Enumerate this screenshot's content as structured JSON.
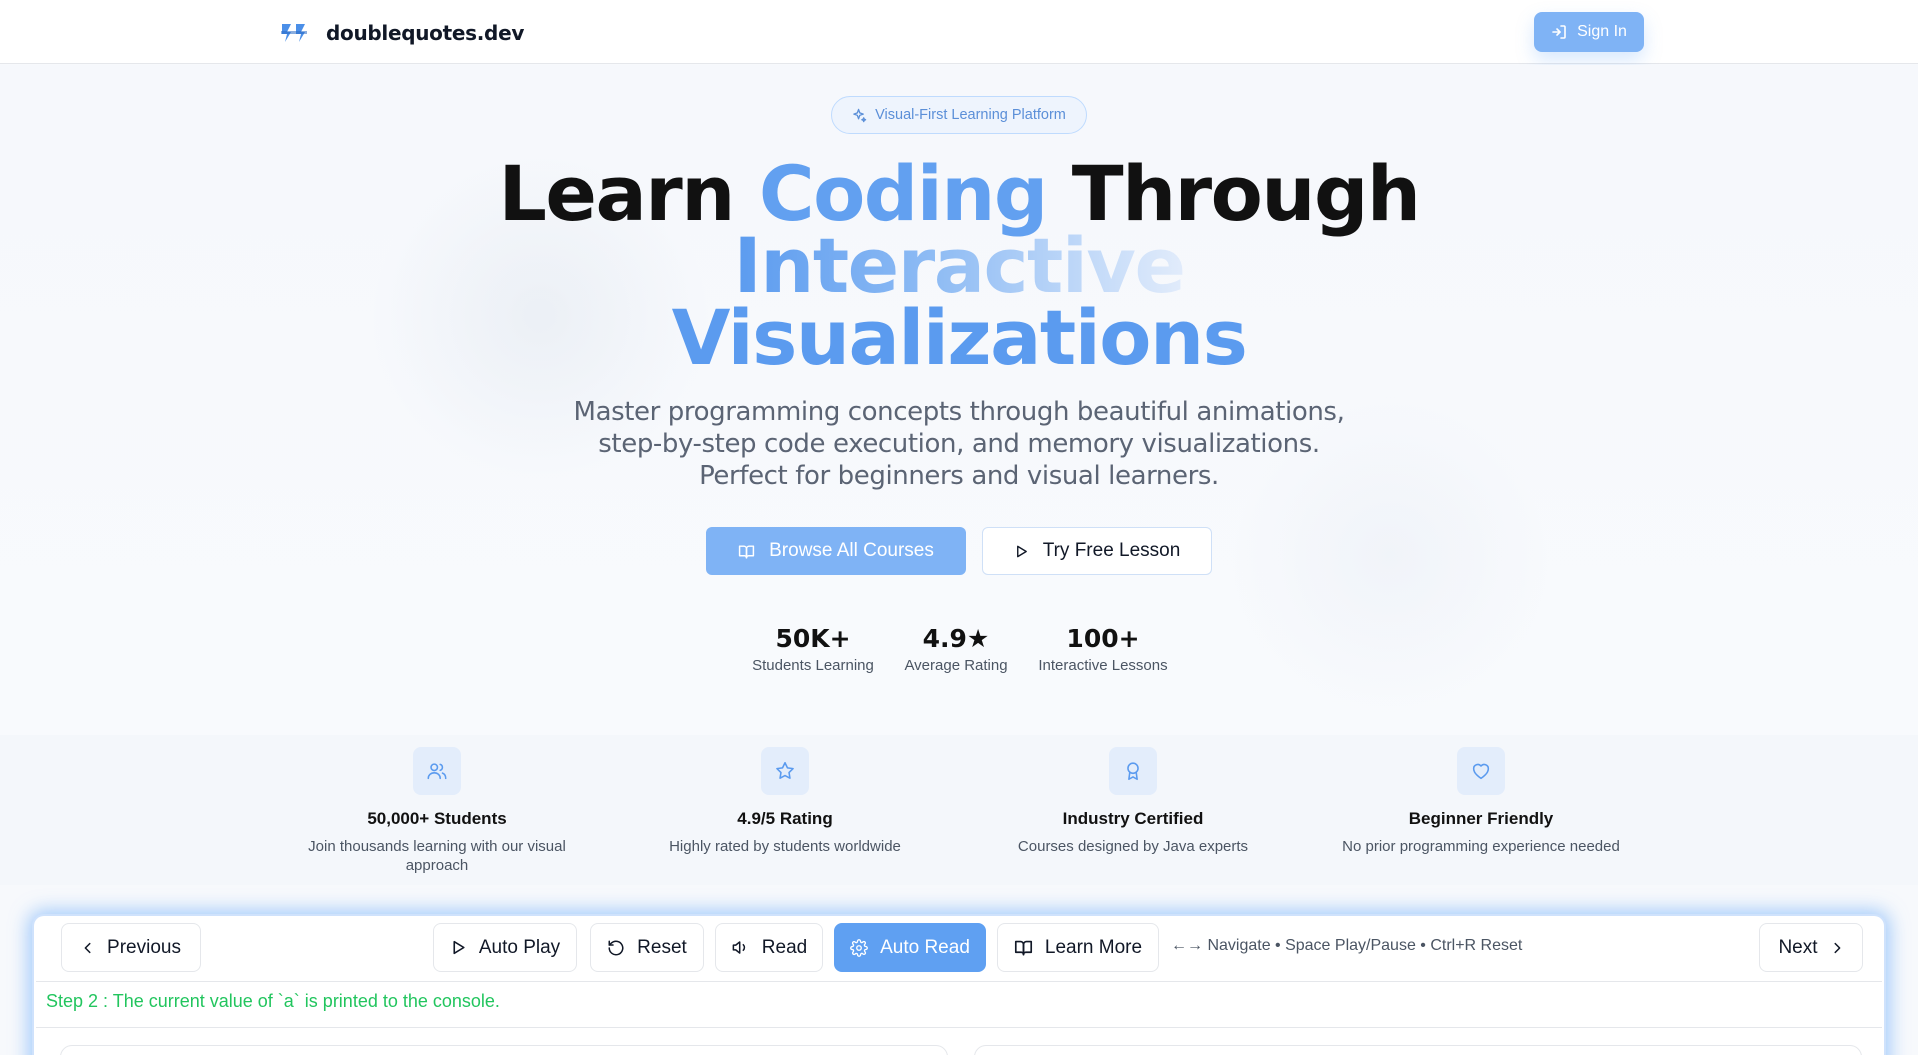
{
  "header": {
    "brand": "doublequotes.dev",
    "sign_in": "Sign In"
  },
  "hero": {
    "badge": "Visual-First Learning Platform",
    "title_part1": "Learn ",
    "title_highlight": "Coding",
    "title_part2": " Through",
    "title_line2": "Interactive",
    "title_line3": "Visualizations",
    "subtitle": "Master programming concepts through beautiful animations, step-by-step code execution, and memory visualizations. Perfect for beginners and visual learners.",
    "primary_button": "Browse All Courses",
    "secondary_button": "Try Free Lesson",
    "stats": [
      {
        "value": "50K+",
        "label": "Students Learning"
      },
      {
        "value": "4.9★",
        "label": "Average Rating"
      },
      {
        "value": "100+",
        "label": "Interactive Lessons"
      }
    ]
  },
  "features": [
    {
      "icon": "users-icon",
      "title": "50,000+ Students",
      "desc": "Join thousands learning with our visual approach"
    },
    {
      "icon": "star-icon",
      "title": "4.9/5 Rating",
      "desc": "Highly rated by students worldwide"
    },
    {
      "icon": "award-icon",
      "title": "Industry Certified",
      "desc": "Courses designed by Java experts"
    },
    {
      "icon": "heart-icon",
      "title": "Beginner Friendly",
      "desc": "No prior programming experience needed"
    }
  ],
  "player": {
    "previous": "Previous",
    "auto_play": "Auto Play",
    "reset": "Reset",
    "read": "Read",
    "auto_read": "Auto Read",
    "learn_more": "Learn More",
    "hint": "←→ Navigate • Space Play/Pause • Ctrl+R Reset",
    "next": "Next",
    "step_text": "Step 2 : The current value of `a` is printed to the console."
  },
  "colors": {
    "accent": "#7fb3f5",
    "accent_strong": "#5fa0f2",
    "step_green": "#22c55e"
  }
}
